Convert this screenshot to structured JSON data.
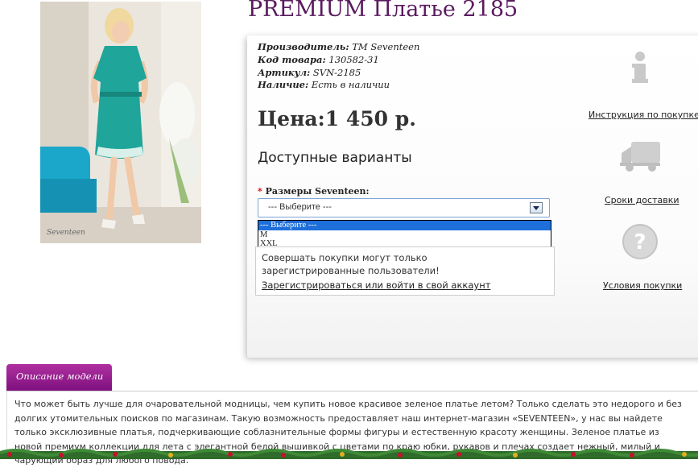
{
  "product": {
    "title": "PREMIUM Платье 2185",
    "manufacturer_label": "Производитель:",
    "manufacturer_value": "TM Seventeen",
    "code_label": "Код товара:",
    "code_value": "130582-31",
    "article_label": "Артикул:",
    "article_value": "SVN-2185",
    "stock_label": "Наличие:",
    "stock_value": "Есть в наличии",
    "price": "Цена:1 450 р.",
    "photo_signature": "Seventeen"
  },
  "options": {
    "heading": "Доступные варианты",
    "required_mark": "*",
    "size_label": "Размеры Seventeen:",
    "select_value": "--- Выберите ---",
    "dropdown_items": [
      "--- Выберите ---",
      "M",
      "XXL"
    ],
    "selected_index": 0
  },
  "notice": {
    "text": "Совершать покупки могут только зарегистрированные пользователи!",
    "link": "Зарегистрироваться или войти в свой аккаунт"
  },
  "side": {
    "items": [
      {
        "label": "Инструкция по покупке",
        "icon": "info-icon"
      },
      {
        "label": "Сроки доставки",
        "icon": "truck-icon"
      },
      {
        "label": "Условия покупки",
        "icon": "question-icon"
      }
    ]
  },
  "description": {
    "tab_label": "Описание модели",
    "text": "Что может быть лучше для очаровательной модницы, чем купить новое красивое зеленое платье летом? Только сделать это недорого и без долгих утомительных поисков по магазинам. Такую возможность предоставляет наш интернет-магазин «SEVENTEEN», у нас вы найдете только эксклюзивные платья, подчеркивающие соблазнительные формы фигуры и естественную красоту женщины. Зеленое платье из новой премиум коллекции для лета с элегантной белой вышивкой с цветами по краю юбки, рукавов и плечах создает нежный, милый и чарующий образ для любого повода."
  },
  "colors": {
    "title": "#5a1a5e",
    "tab": "#8e1a8e",
    "dress": "#1fa59a",
    "select_highlight": "#1e6fd9"
  }
}
